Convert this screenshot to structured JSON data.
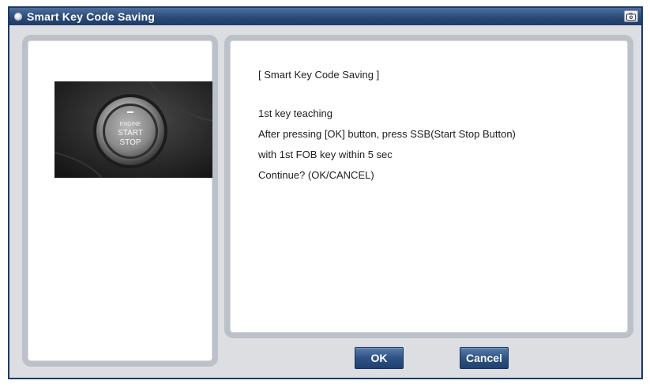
{
  "window": {
    "title": "Smart Key Code Saving"
  },
  "image": {
    "button_line1": "ENGINE",
    "button_line2": "START",
    "button_line3": "STOP"
  },
  "message": {
    "header": "[ Smart Key Code Saving ]",
    "lines": [
      "1st key teaching",
      "After pressing [OK] button, press SSB(Start Stop Button)",
      "with 1st FOB key within 5 sec",
      "Continue? (OK/CANCEL)"
    ]
  },
  "buttons": {
    "ok_label": "OK",
    "cancel_label": "Cancel"
  },
  "colors": {
    "titlebar": "#2a4a78",
    "button": "#2d5386",
    "panel_border": "#bcc1c9",
    "window_bg": "#dcdee2"
  },
  "icons": {
    "title": "window-icon",
    "titlebar_button": "camera-icon"
  }
}
